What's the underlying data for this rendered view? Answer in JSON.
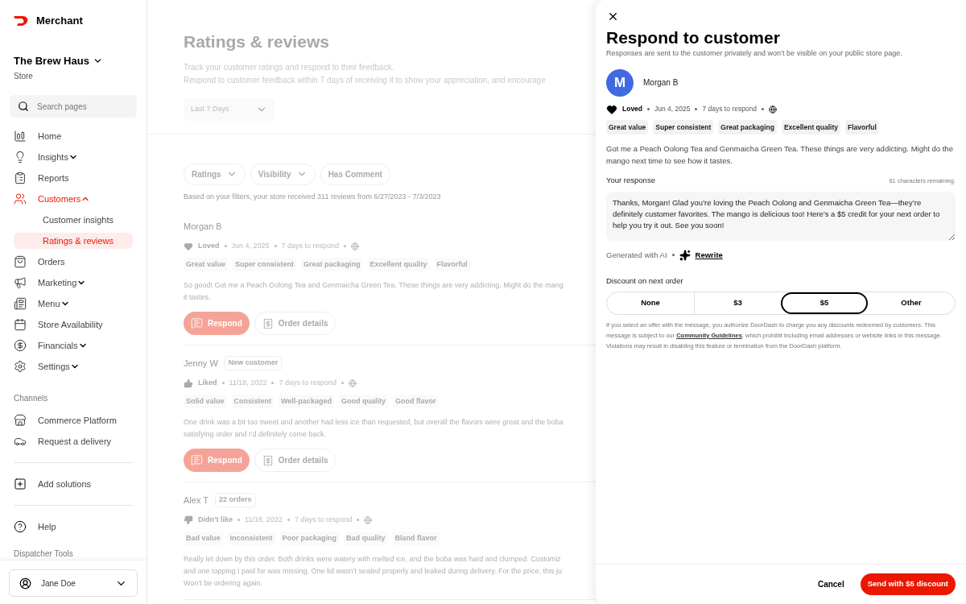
{
  "sidebar": {
    "brand": "Merchant",
    "store_name": "The Brew Haus",
    "store_label": "Store",
    "search": {
      "placeholder": "Search pages"
    },
    "nav": [
      {
        "label": "Home",
        "selected": false
      },
      {
        "label": "Insights",
        "selected": false,
        "expanded": false
      },
      {
        "label": "Reports",
        "selected": false
      },
      {
        "label": "Customers",
        "selected": true,
        "expanded": true,
        "children": [
          {
            "label": "Customer insights",
            "selected": false
          },
          {
            "label": "Ratings & reviews",
            "selected": true
          }
        ]
      },
      {
        "label": "Orders",
        "selected": false
      },
      {
        "label": "Marketing",
        "selected": false,
        "expanded": false
      },
      {
        "label": "Menu",
        "selected": false,
        "expanded": false
      },
      {
        "label": "Store Availability",
        "selected": false
      },
      {
        "label": "Financials",
        "selected": false,
        "expanded": false
      },
      {
        "label": "Settings",
        "selected": false,
        "expanded": false
      }
    ],
    "channels_heading": "Channels",
    "channels": [
      {
        "label": "Commerce Platform",
        "selected": false
      },
      {
        "label": "Request a delivery",
        "selected": false
      }
    ],
    "add_solutions": "Add solutions",
    "help": "Help",
    "dispatcher_heading": "Dispatcher Tools",
    "user": "Jane Doe"
  },
  "main": {
    "title": "Ratings & reviews",
    "subtitle_lines": [
      "Track your customer ratings and respond to their feedback.",
      "Respond to customer feedback within 7 days of receiving it to show your appreciation, and encourage"
    ],
    "date_filter": "Last 7 Days",
    "filters": [
      {
        "label": "Ratings",
        "has_menu": true
      },
      {
        "label": "Visibility",
        "has_menu": true
      },
      {
        "label": "Has Comment",
        "has_menu": false
      }
    ],
    "summary": "Based on your filters, your store received 311 reviews from 6/27/2023 - 7/3/2023",
    "reviews": [
      {
        "name": "Morgan B",
        "sentiment": {
          "kind": "loved",
          "label": "Loved"
        },
        "date": "Jun 4, 2025",
        "deadline": "7 days to respond",
        "tags": [
          "Great value",
          "Super consistent",
          "Great packaging",
          "Excellent quality",
          "Flavorful"
        ],
        "text_lines": [
          "So good! Got me a Peach Oolong Tea and Genmaicha Green Tea. These things are very addicting. Might do the mang",
          "it tastes."
        ],
        "actions": {
          "respond": "Respond",
          "order_details": "Order details"
        }
      },
      {
        "name": "Jenny W",
        "badge": "New customer",
        "sentiment": {
          "kind": "liked",
          "label": "Liked"
        },
        "date": "11/18, 2022",
        "deadline": "7 days to respond",
        "tags": [
          "Solid value",
          "Consistent",
          "Well-packaged",
          "Good quality",
          "Good flavor"
        ],
        "text_lines": [
          "One drink was a bit too sweet and another had less ice than requested, but overall the flavors were great and the boba",
          "satisfying order and I’d definitely come back."
        ],
        "actions": {
          "respond": "Respond",
          "order_details": "Order details"
        }
      },
      {
        "name": "Alex T",
        "badge": "22 orders",
        "sentiment": {
          "kind": "disliked",
          "label": "Didn’t like"
        },
        "date": "11/18, 2022",
        "deadline": "7 days to respond",
        "tags": [
          "Bad value",
          "Inconsistent",
          "Poor packaging",
          "Bad quality",
          "Bland flavor"
        ],
        "text_lines": [
          "Really let down by this order. Both drinks were watery with melted ice, and the boba was hard and clumped. Customiz",
          "and one topping I paid for was missing. One lid wasn’t sealed properly and leaked during delivery. For the price, this ju",
          "Won’t be ordering again."
        ]
      }
    ]
  },
  "drawer": {
    "title": "Respond to customer",
    "subtitle": "Responses are sent to the customer privately and won’t be visible on your public store page.",
    "customer": {
      "initial": "M",
      "name": "Morgan B"
    },
    "sentiment": {
      "kind": "loved",
      "label": "Loved"
    },
    "date": "Jun 4, 2025",
    "deadline": "7 days to respond",
    "tags": [
      "Great value",
      "Super consistent",
      "Great packaging",
      "Excellent quality",
      "Flavorful"
    ],
    "review": "Got me a Peach Oolong Tea and Genmaicha Green Tea. These things are very addicting. Might do the mango next time to see how it tastes.",
    "response": {
      "label": "Your response",
      "counter": "61 characters remaining.",
      "value": "Thanks, Morgan! Glad you’re loving the Peach Oolong and Genmaicha Green Tea—they’re definitely customer favorites. The mango is delicious too! Here’s a $5 credit for your next order to help you try it out. See you soon!"
    },
    "ai_note": "Generated with AI",
    "rewrite": "Rewrite",
    "discount": {
      "label": "Discount on next order",
      "options": [
        {
          "label": "None",
          "selected": false
        },
        {
          "label": "$3",
          "selected": false
        },
        {
          "label": "$5",
          "selected": true
        },
        {
          "label": "Other",
          "selected": false
        }
      ]
    },
    "disclaimer": {
      "before": "If you select an offer with the message, you authorize DoorDash to charge you any discounts redeemed by customers. This message is subject to our",
      "link": "Community Guidelines",
      "after": ", which prohibit including email addresses or website links in this message. Violations may result in disabling this feature or termination from the DoorDash platform."
    },
    "cancel": "Cancel",
    "submit": "Send with $5 discount"
  }
}
